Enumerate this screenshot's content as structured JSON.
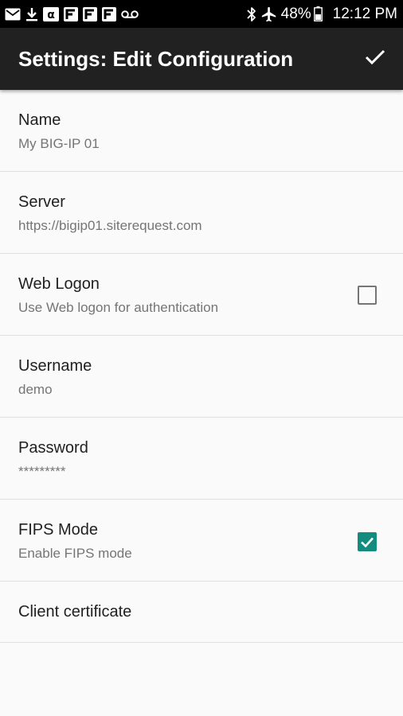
{
  "status_bar": {
    "battery_percent": "48%",
    "time": "12:12 PM",
    "left_icons": [
      "mail-icon",
      "download-icon",
      "alpha-app-icon",
      "f5-app-icon",
      "f5-app-icon",
      "f5-app-icon",
      "voicemail-icon"
    ],
    "right_icons": [
      "bluetooth-icon",
      "airplane-mode-icon",
      "battery-icon"
    ]
  },
  "toolbar": {
    "title": "Settings: Edit Configuration",
    "done_icon": "checkmark-icon"
  },
  "preferences": [
    {
      "title": "Name",
      "summary": "My BIG-IP 01"
    },
    {
      "title": "Server",
      "summary": "https://bigip01.siterequest.com"
    },
    {
      "title": "Web Logon",
      "summary": "Use Web logon for authentication",
      "checkbox": false
    },
    {
      "title": "Username",
      "summary": "demo"
    },
    {
      "title": "Password",
      "summary": "*********"
    },
    {
      "title": "FIPS Mode",
      "summary": "Enable FIPS mode",
      "checkbox": true
    },
    {
      "title": "Client certificate",
      "summary": ""
    }
  ],
  "colors": {
    "status_bar": "#000000",
    "toolbar": "#212121",
    "background": "#fafafa",
    "checkbox_checked": "#128c7e",
    "divider": "#e0e0e0",
    "summary_text": "#757575"
  }
}
